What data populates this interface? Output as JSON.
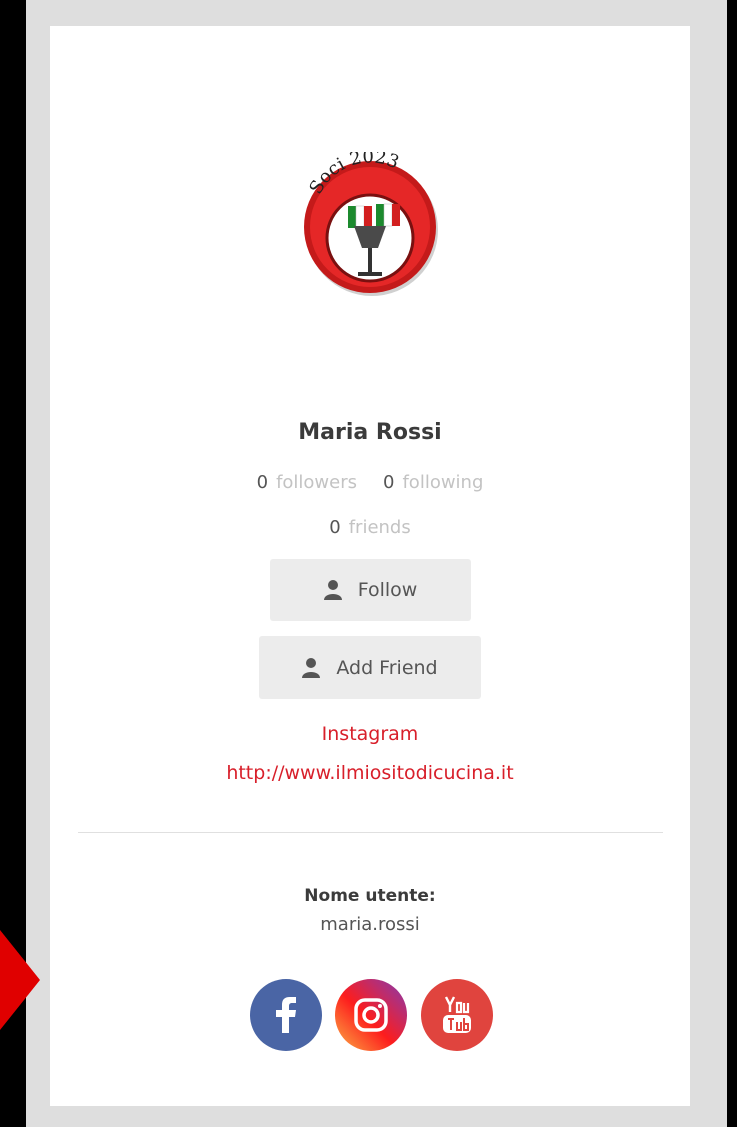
{
  "profile": {
    "name": "Maria Rossi",
    "avatar_text": "Soci 2023",
    "followers_count": "0",
    "followers_label": "followers",
    "following_count": "0",
    "following_label": "following",
    "friends_count": "0",
    "friends_label": "friends"
  },
  "actions": {
    "follow_label": "Follow",
    "add_friend_label": "Add Friend"
  },
  "links": {
    "instagram": "Instagram",
    "website": "http://www.ilmiositodicucina.it"
  },
  "details": {
    "username_label": "Nome utente:",
    "username_value": "maria.rossi"
  },
  "social": {
    "icons": [
      "facebook-icon",
      "instagram-icon",
      "youtube-icon"
    ]
  },
  "colors": {
    "link_red": "#d81f2a",
    "facebook": "#4a65a5",
    "youtube": "#e0443e",
    "button_bg": "#ececec"
  }
}
